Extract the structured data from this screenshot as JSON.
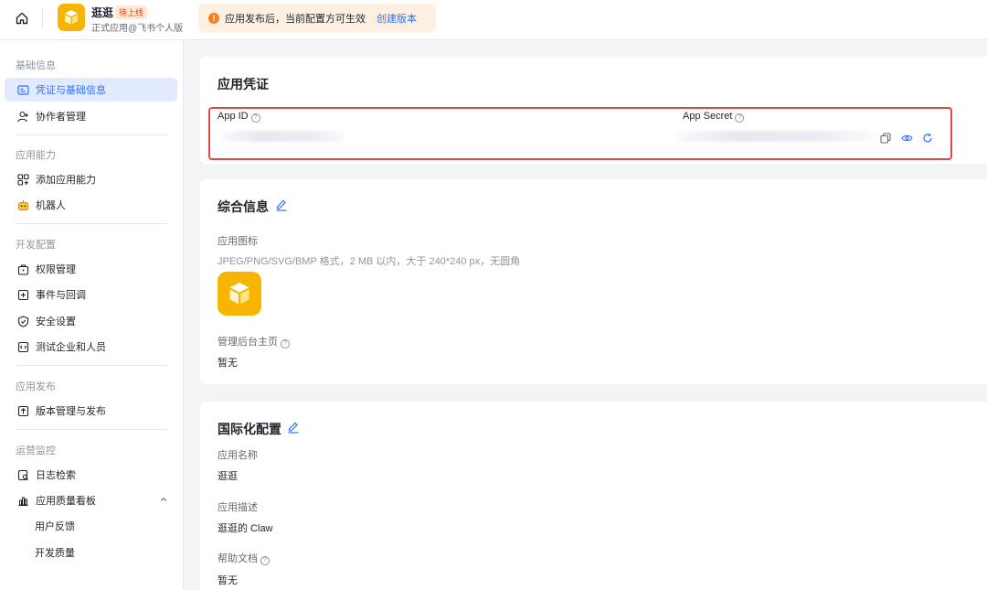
{
  "header": {
    "app_name": "逛逛",
    "app_badge": "待上线",
    "app_sub": "正式应用@飞书个人版",
    "notice_text": "应用发布后，当前配置方可生效",
    "notice_link": "创建版本"
  },
  "sidebar": {
    "groups": [
      {
        "title": "基础信息",
        "items": [
          "凭证与基础信息",
          "协作者管理"
        ]
      },
      {
        "title": "应用能力",
        "items": [
          "添加应用能力",
          "机器人"
        ]
      },
      {
        "title": "开发配置",
        "items": [
          "权限管理",
          "事件与回调",
          "安全设置",
          "测试企业和人员"
        ]
      },
      {
        "title": "应用发布",
        "items": [
          "版本管理与发布"
        ]
      },
      {
        "title": "运营监控",
        "items": [
          "日志检索",
          "应用质量看板",
          "用户反馈",
          "开发质量"
        ]
      }
    ]
  },
  "credentials": {
    "title": "应用凭证",
    "app_id_label": "App ID",
    "app_secret_label": "App Secret"
  },
  "general": {
    "title": "综合信息",
    "icon_label": "应用图标",
    "icon_hint": "JPEG/PNG/SVG/BMP 格式，2 MB 以内，大于 240*240 px，无圆角",
    "homepage_label": "管理后台主页",
    "homepage_value": "暂无"
  },
  "i18n": {
    "title": "国际化配置",
    "name_label": "应用名称",
    "name_value": "逛逛",
    "desc_label": "应用描述",
    "desc_value": "逛逛的 Claw",
    "help_label": "帮助文档",
    "help_value": "暂无"
  },
  "colors": {
    "accent": "#3370ff",
    "app_icon": "#f7b500",
    "highlight_box": "#e04848",
    "notice_bg": "#fdf0e3"
  }
}
